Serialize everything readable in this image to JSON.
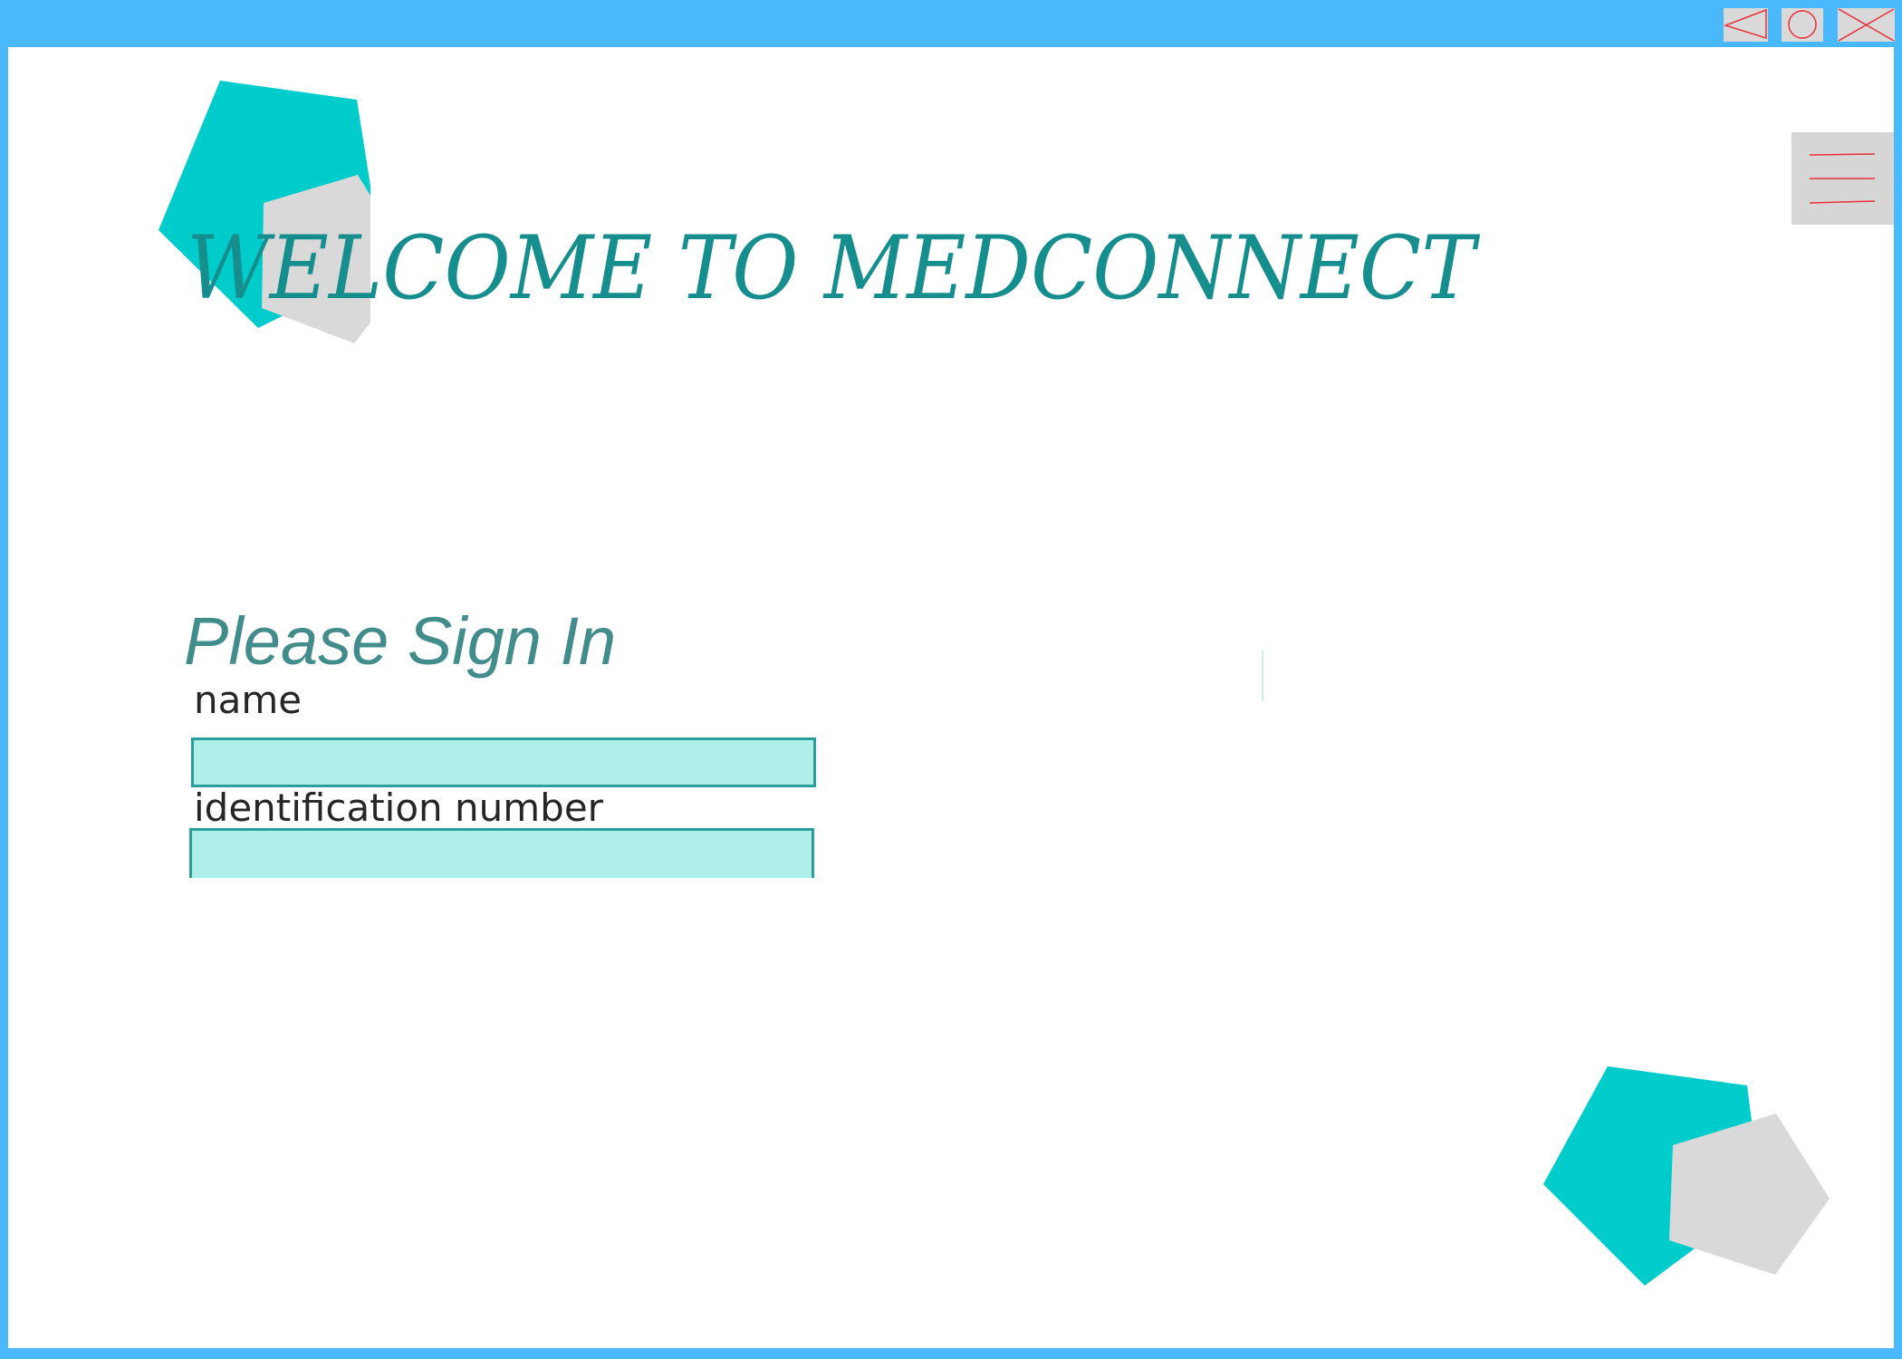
{
  "window": {
    "controls": {
      "back_icon": "triangle-left-icon",
      "home_icon": "circle-icon",
      "close_icon": "close-x-icon",
      "icon_color": "#e8303a",
      "button_color": "#d9d9d9"
    },
    "frame_color": "#4ab9fb",
    "menu_icon": "hamburger-menu-icon"
  },
  "header": {
    "title": "WELCOME TO MEDCONNECT",
    "title_color": "#168e8e"
  },
  "signin": {
    "heading": "Please Sign In",
    "heading_color": "#428c8c",
    "fields": [
      {
        "label": "name",
        "value": ""
      },
      {
        "label": "identification number",
        "value": ""
      }
    ],
    "field_fill": "#aef0e9",
    "field_border": "#2a9d9d"
  },
  "decor": {
    "primary_color": "#00cccc",
    "secondary_color": "#d9d9d9"
  }
}
